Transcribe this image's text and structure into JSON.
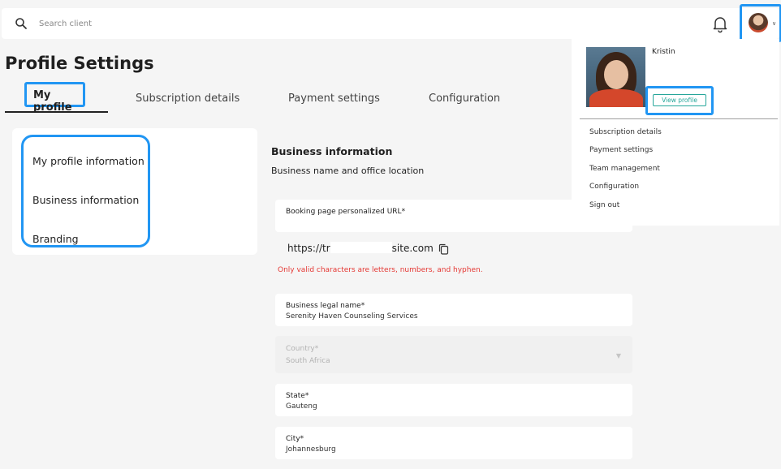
{
  "header": {
    "search_placeholder": "Search client"
  },
  "page": {
    "title": "Profile Settings"
  },
  "tabs": [
    {
      "label": "My profile"
    },
    {
      "label": "Subscription details"
    },
    {
      "label": "Payment settings"
    },
    {
      "label": "Configuration"
    }
  ],
  "left_menu": [
    {
      "label": "My profile information"
    },
    {
      "label": "Business information"
    },
    {
      "label": "Branding"
    }
  ],
  "section": {
    "title": "Business information",
    "subtitle": "Business name and office location"
  },
  "fields": {
    "booking_url": {
      "label": "Booking page personalized URL*",
      "value_prefix": "https://tr",
      "value_suffix": "site.com",
      "error": "Only valid characters are letters, numbers, and hyphen."
    },
    "legal_name": {
      "label": "Business legal name*",
      "value": "Serenity Haven Counseling Services"
    },
    "country": {
      "label": "Country*",
      "value": "South Africa"
    },
    "state": {
      "label": "State*",
      "value": "Gauteng"
    },
    "city": {
      "label": "City*",
      "value": "Johannesburg"
    }
  },
  "profile_menu": {
    "name": "Kristin",
    "view_profile_label": "View profile",
    "items": [
      {
        "label": "Subscription details"
      },
      {
        "label": "Payment settings"
      },
      {
        "label": "Team management"
      },
      {
        "label": "Configuration"
      },
      {
        "label": "Sign out"
      }
    ]
  },
  "colors": {
    "highlight": "#2196f3",
    "error": "#e53935",
    "accent": "#26a69a"
  }
}
